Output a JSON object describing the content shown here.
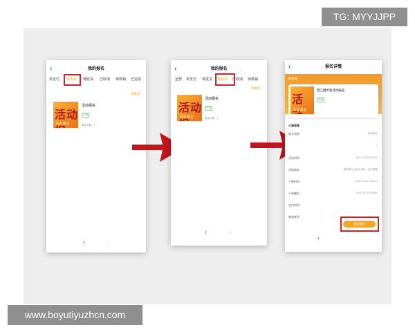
{
  "watermark_tg": "TG: MYYJJPP",
  "watermark_site": "www.boyutiyuzhcn.com",
  "screen1": {
    "title": "我的报名",
    "back": "‹",
    "tabs": [
      "未支付",
      "待发货",
      "待收货",
      "已取消",
      "待核销",
      "已完成"
    ],
    "status": "待发货",
    "thumb_text": "活动报",
    "thumb_sub": "活 动 报 名",
    "card_title": "活动报名",
    "tag": "不退",
    "meta": "参加人数：1",
    "nav_prev": "‹",
    "nav_next": "›"
  },
  "screen2": {
    "title": "我的报名",
    "back": "‹",
    "tabs": [
      "全部",
      "未支付",
      "待发货",
      "待收货",
      "已取消",
      "待核销"
    ],
    "status": "待收货",
    "thumb_text": "活动报",
    "thumb_sub": "活 动 报 名",
    "card_title": "活动报名",
    "tag": "不退",
    "meta": "参加人数：1",
    "nav_prev": "‹",
    "nav_next": "›"
  },
  "screen3": {
    "title": "报名详情",
    "back": "‹",
    "status": "待收货",
    "card_title": "西江健步跑活动报名",
    "tag": "不退",
    "section": "订单信息",
    "rows": [
      {
        "label": "报名须知",
        "value": "参考指引"
      },
      {
        "label": "",
        "value": "1"
      },
      {
        "label": "活动时间",
        "value": "2021-11-29 09:00:00"
      },
      {
        "label": "活动地址",
        "value": "梅村镇三分区木桥街，西江群屋"
      },
      {
        "label": "下单时间",
        "value": "2021-11-29 11:56:31"
      },
      {
        "label": "订单编号",
        "value": "2021072716254491"
      },
      {
        "label": "支付时间",
        "value": ""
      },
      {
        "label": "物流单号",
        "value": ""
      }
    ],
    "button": "确认收货",
    "nav_prev": "‹",
    "nav_next": "›"
  },
  "colors": {
    "accent": "#f5a623",
    "highlight": "#d0202a",
    "arrow": "#c0161d"
  }
}
